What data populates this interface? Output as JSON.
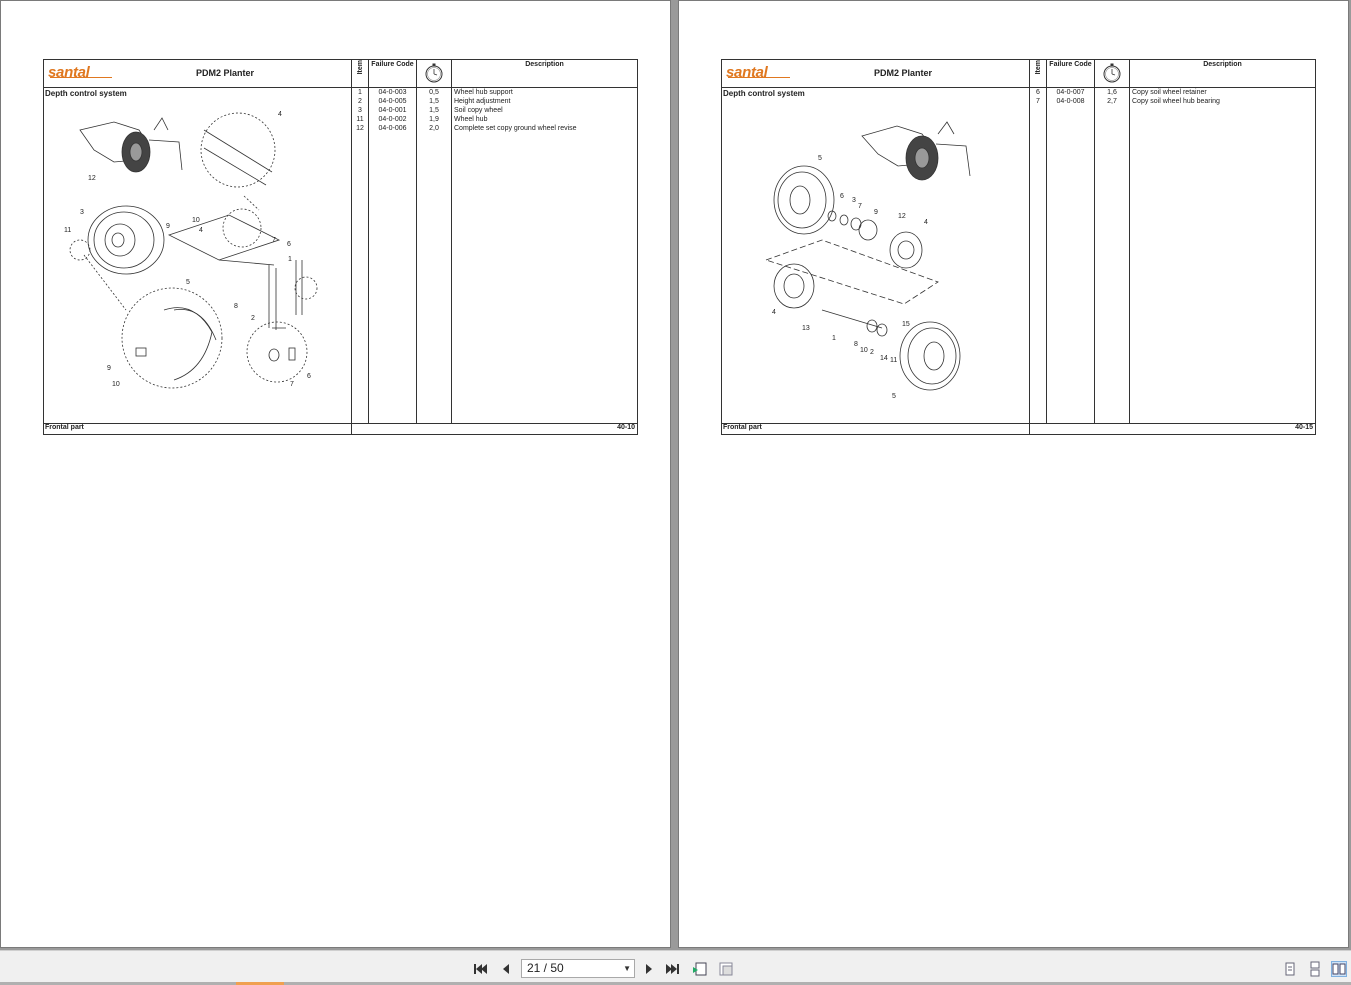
{
  "brand": "santal",
  "pages": [
    {
      "product": "PDM2 Planter",
      "headers": {
        "item": "Item",
        "failure_code": "Failure Code",
        "description": "Description"
      },
      "section": "Depth control system",
      "rows": [
        {
          "item": "1",
          "code": "04-0-003",
          "time": "0,5",
          "desc": "Wheel hub support"
        },
        {
          "item": "2",
          "code": "04-0-005",
          "time": "1,5",
          "desc": "Height adjustment"
        },
        {
          "item": "3",
          "code": "04-0-001",
          "time": "1,5",
          "desc": "Soil copy wheel"
        },
        {
          "item": "11",
          "code": "04-0-002",
          "time": "1,9",
          "desc": "Wheel hub"
        },
        {
          "item": "12",
          "code": "04-0-006",
          "time": "2,0",
          "desc": "Complete set copy ground wheel revise"
        }
      ],
      "footer_label": "Frontal part",
      "page_number": "40-10"
    },
    {
      "product": "PDM2 Planter",
      "headers": {
        "item": "Item",
        "failure_code": "Failure Code",
        "description": "Description"
      },
      "section": "Depth control system",
      "rows": [
        {
          "item": "6",
          "code": "04-0-007",
          "time": "1,6",
          "desc": "Copy soil wheel retainer"
        },
        {
          "item": "7",
          "code": "04-0-008",
          "time": "2,7",
          "desc": "Copy soil wheel hub bearing"
        }
      ],
      "footer_label": "Frontal part",
      "page_number": "40-15"
    }
  ],
  "diagram_callouts_left": [
    "4",
    "12",
    "3",
    "10",
    "9",
    "4",
    "11",
    "7",
    "6",
    "1",
    "5",
    "8",
    "2",
    "9",
    "10",
    "7",
    "6"
  ],
  "diagram_callouts_right": [
    "5",
    "6",
    "3",
    "7",
    "9",
    "12",
    "4",
    "4",
    "13",
    "1",
    "8",
    "10",
    "2",
    "14",
    "11",
    "15",
    "5"
  ],
  "toolbar": {
    "page_indicator": "21 / 50",
    "icons": [
      "first-page-icon",
      "prev-page-icon",
      "next-page-icon",
      "last-page-icon",
      "fit-page-icon",
      "fit-width-icon",
      "single-page-icon",
      "continuous-page-icon",
      "two-page-icon"
    ]
  }
}
